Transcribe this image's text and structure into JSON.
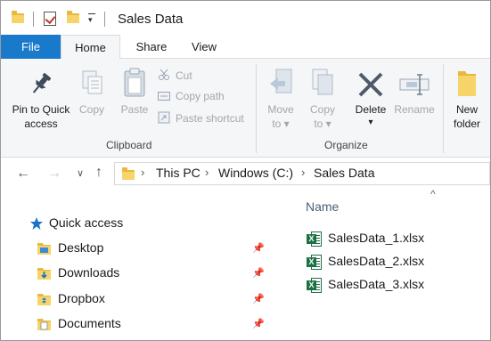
{
  "window": {
    "title": "Sales Data"
  },
  "ribbon": {
    "tabs": [
      {
        "label": "File"
      },
      {
        "label": "Home"
      },
      {
        "label": "Share"
      },
      {
        "label": "View"
      }
    ],
    "clipboard": {
      "group_label": "Clipboard",
      "pin_label_1": "Pin to Quick",
      "pin_label_2": "access",
      "copy_label": "Copy",
      "paste_label": "Paste",
      "cut_label": "Cut",
      "copy_path_label": "Copy path",
      "paste_shortcut_label": "Paste shortcut"
    },
    "organize": {
      "group_label": "Organize",
      "move_to_label_1": "Move",
      "move_to_label_2": "to",
      "copy_to_label_1": "Copy",
      "copy_to_label_2": "to",
      "delete_label": "Delete",
      "rename_label": "Rename"
    },
    "new": {
      "new_folder_label_1": "New",
      "new_folder_label_2": "folder"
    }
  },
  "address": {
    "crumbs": [
      "This PC",
      "Windows (C:)",
      "Sales Data"
    ]
  },
  "navigation_pane": {
    "quick_access": "Quick access",
    "items": [
      {
        "label": "Desktop",
        "icon": "desktop-folder-icon",
        "pinned": true
      },
      {
        "label": "Downloads",
        "icon": "downloads-folder-icon",
        "pinned": true
      },
      {
        "label": "Dropbox",
        "icon": "dropbox-folder-icon",
        "pinned": true
      },
      {
        "label": "Documents",
        "icon": "documents-folder-icon",
        "pinned": true
      }
    ]
  },
  "file_list": {
    "column_name": "Name",
    "files": [
      {
        "name": "SalesData_1.xlsx",
        "icon": "excel-file-icon"
      },
      {
        "name": "SalesData_2.xlsx",
        "icon": "excel-file-icon"
      },
      {
        "name": "SalesData_3.xlsx",
        "icon": "excel-file-icon"
      }
    ]
  },
  "colors": {
    "file_tab": "#1979ca",
    "ribbon_bg": "#f5f6f7",
    "folder": "#f7d46a",
    "excel": "#1e7145",
    "quick_access_star": "#1a73c9"
  }
}
